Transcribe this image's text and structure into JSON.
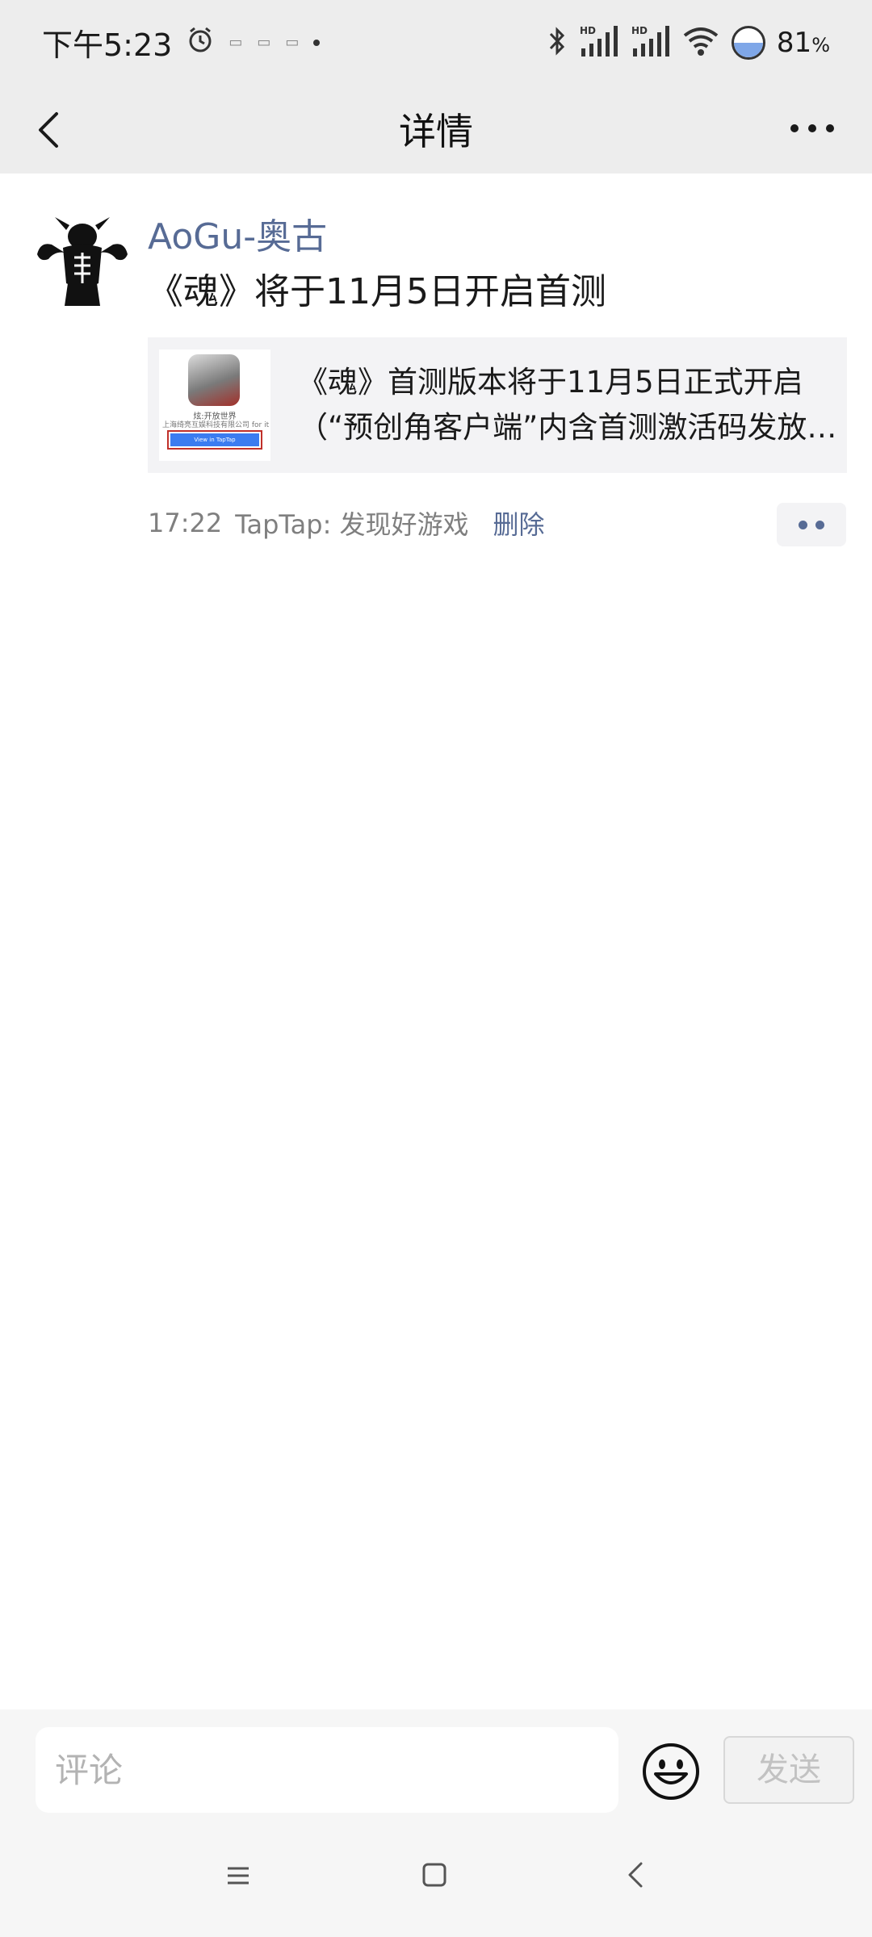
{
  "status_bar": {
    "time": "下午5:23",
    "mini_icons": [
      "▭",
      "▭",
      "▭"
    ],
    "battery": "81",
    "battery_unit": "%"
  },
  "header": {
    "title": "详情"
  },
  "post": {
    "author": "AoGu-奥古",
    "text": "《魂》将于11月5日开启首测",
    "link_card": {
      "line1": "《魂》首测版本将于11月5日正式开启",
      "line2": "（“预创角客户端”内含首测激活码发放…",
      "thumb_text1": "炫:开放世界",
      "thumb_text2": "上海绮亮互娱科技有限公司 for it",
      "thumb_button": "View in TapTap"
    },
    "time": "17:22",
    "source": "TapTap: 发现好游戏",
    "delete_label": "删除"
  },
  "comment_bar": {
    "placeholder": "评论",
    "send_label": "发送"
  },
  "colors": {
    "link_blue": "#576b95",
    "bar_gray": "#ededed",
    "card_bg": "#f3f3f5"
  }
}
